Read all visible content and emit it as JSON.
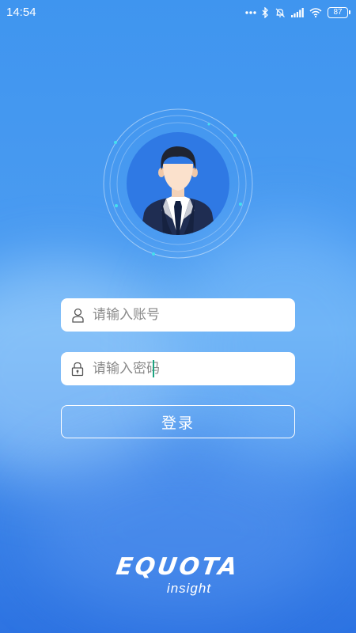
{
  "status_bar": {
    "time": "14:54",
    "battery": "87",
    "icons": [
      "more-dots-icon",
      "bluetooth-icon",
      "mute-bell-icon",
      "signal-icon",
      "wifi-icon",
      "battery-icon"
    ]
  },
  "avatar": {
    "icon": "user-avatar-icon"
  },
  "login_form": {
    "username_placeholder": "请输入账号",
    "username_icon": "user-icon",
    "password_placeholder": "请输入密码",
    "password_icon": "lock-icon",
    "submit_label": "登录"
  },
  "brand": {
    "logo_text": "EQUOTA",
    "subtitle": "insight"
  },
  "colors": {
    "background_top": "#3f95ef",
    "background_bottom": "#2d73e2",
    "avatar_circle": "#2f79e4",
    "field_background": "#ffffff",
    "caret": "#1aa37f"
  }
}
